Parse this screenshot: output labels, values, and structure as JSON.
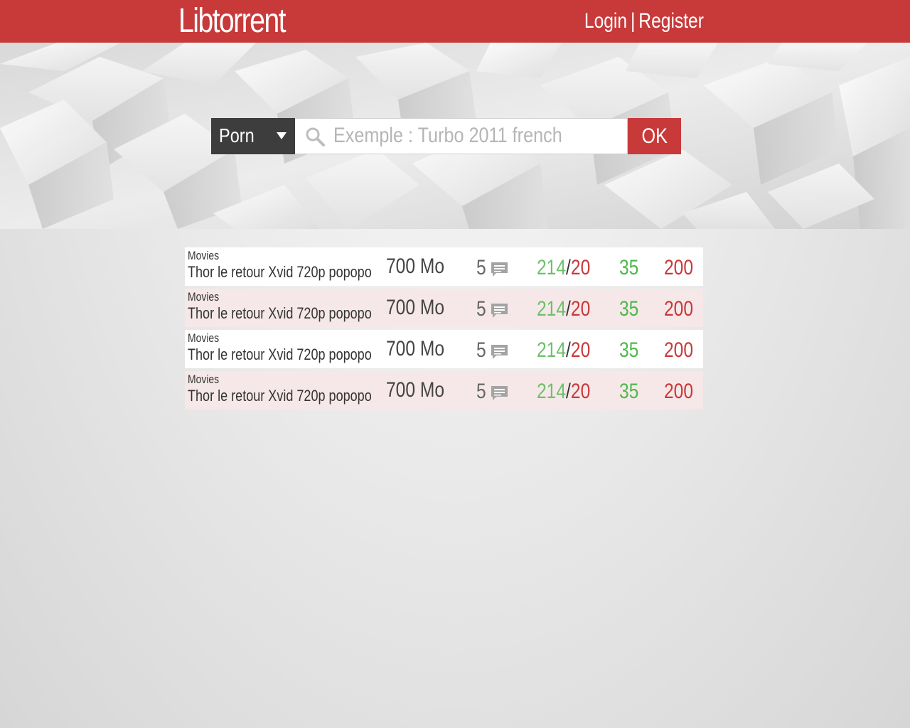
{
  "header": {
    "logo": "Libtorrent",
    "login": "Login",
    "separator": "|",
    "register": "Register"
  },
  "search": {
    "category": "Porn",
    "placeholder": "Exemple : Turbo 2011 french",
    "value": "",
    "submit": "OK"
  },
  "results": [
    {
      "category": "Movies",
      "title": "Thor le retour Xvid 720p popopo",
      "size": "700 Mo",
      "comments": "5",
      "seeders": "214",
      "slash": "/",
      "leechers": "20",
      "completed": "35",
      "age": "200"
    },
    {
      "category": "Movies",
      "title": "Thor le retour Xvid 720p popopo",
      "size": "700 Mo",
      "comments": "5",
      "seeders": "214",
      "slash": "/",
      "leechers": "20",
      "completed": "35",
      "age": "200"
    },
    {
      "category": "Movies",
      "title": "Thor le retour Xvid 720p popopo",
      "size": "700 Mo",
      "comments": "5",
      "seeders": "214",
      "slash": "/",
      "leechers": "20",
      "completed": "35",
      "age": "200"
    },
    {
      "category": "Movies",
      "title": "Thor le retour Xvid 720p popopo",
      "size": "700 Mo",
      "comments": "5",
      "seeders": "214",
      "slash": "/",
      "leechers": "20",
      "completed": "35",
      "age": "200"
    }
  ],
  "icons": {
    "search": "search-icon",
    "comments": "comment-icon",
    "dropdown": "chevron-down-icon"
  },
  "colors": {
    "brand": "#c8393a",
    "dark": "#3d3d3d",
    "seeders": "#6cc06a",
    "completed": "#4eb84c",
    "alt_row": "#f6e8e8"
  }
}
